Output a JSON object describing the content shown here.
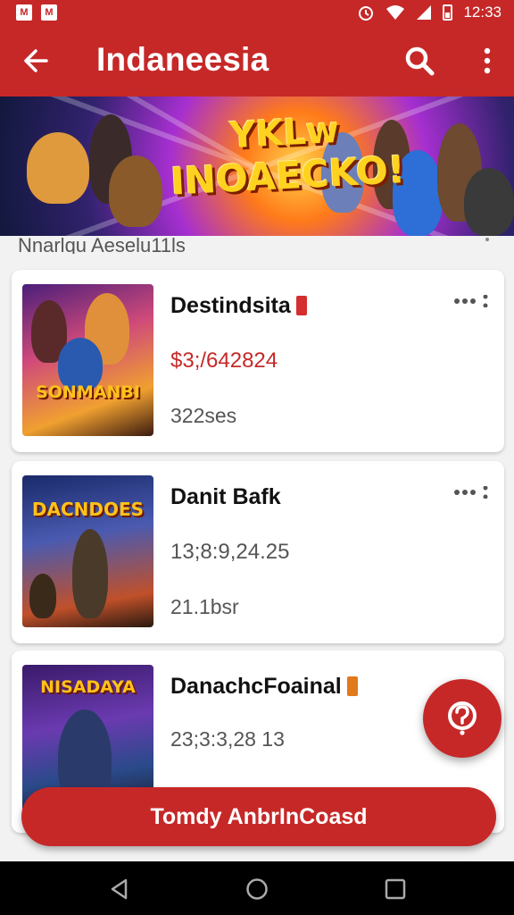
{
  "status_bar": {
    "time": "12:33"
  },
  "app_bar": {
    "title": "Indaneesia"
  },
  "banner": {
    "line1": "YKLw",
    "line2": "INOAECKO!"
  },
  "section": {
    "header": "Nnarlqu Aeselu11ls"
  },
  "items": [
    {
      "name": "Destindsita",
      "price": "$3;/642824",
      "meta": "322ses",
      "thumb_title": "SONMANBI"
    },
    {
      "name": "Danit Bafk",
      "price": "13;8:9,24.25",
      "meta": "21.1bsr",
      "thumb_title": "DACNDOES"
    },
    {
      "name": "DanachcFoainal",
      "price": "",
      "meta": "23;3:3,28 13",
      "thumb_title": "NISADAYA"
    }
  ],
  "primary_button": {
    "label": "Tomdy AnbrInCoasd"
  },
  "colors": {
    "accent": "#c62828",
    "price": "#c62828"
  },
  "icons": [
    "back-arrow-icon",
    "search-icon",
    "more-vert-icon",
    "more-horiz-icon",
    "help-icon",
    "nav-back-icon",
    "nav-home-icon",
    "nav-recents-icon"
  ]
}
